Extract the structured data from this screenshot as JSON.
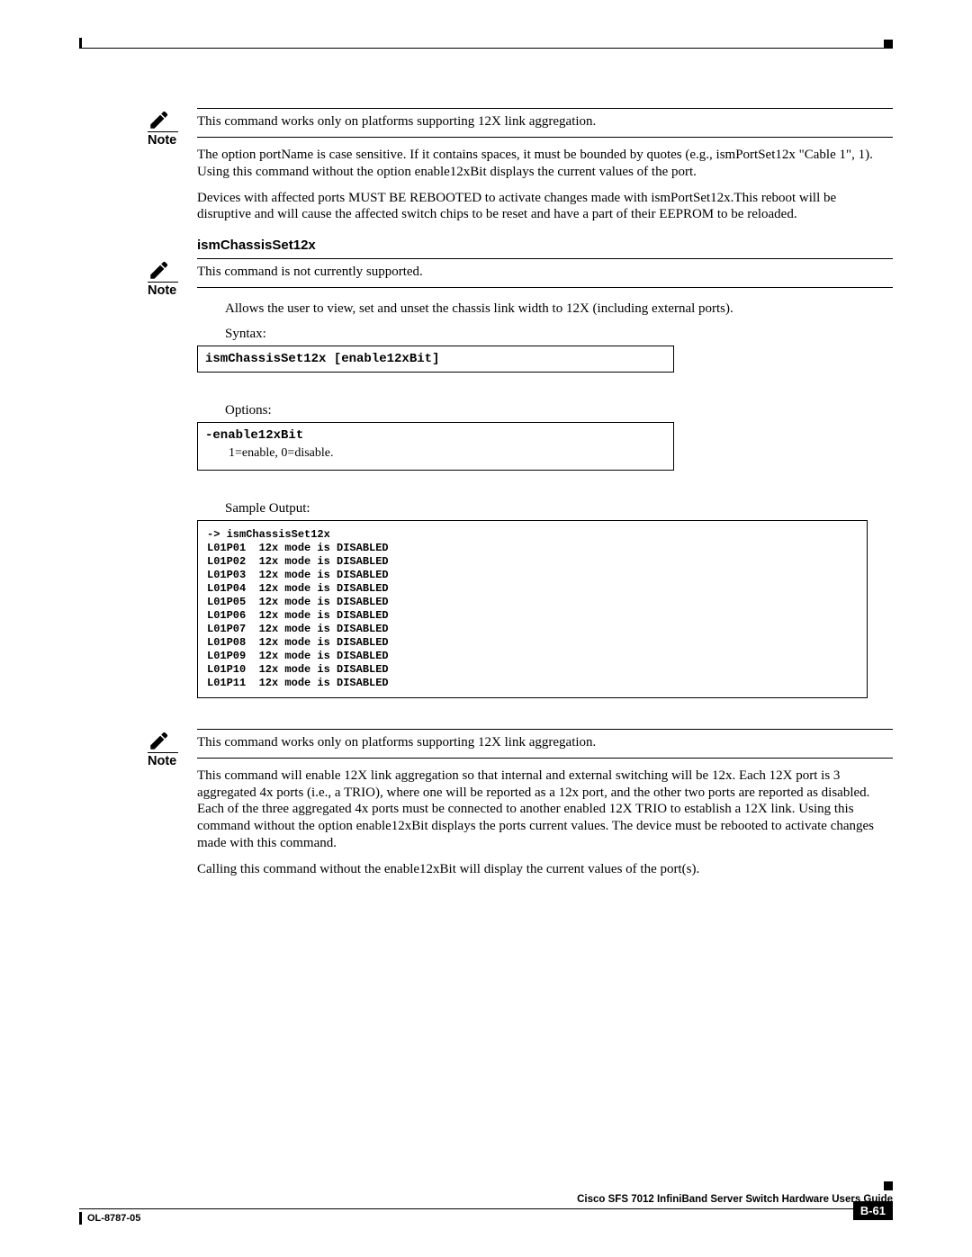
{
  "notes": {
    "label": "Note",
    "n1": "This command works only on platforms supporting 12X link aggregation.",
    "n2": "This command is not currently supported.",
    "n3": "This command works only on platforms supporting 12X link aggregation."
  },
  "paras": {
    "p1": "The option portName is case sensitive. If it contains spaces, it must be bounded by quotes (e.g., ismPortSet12x \"Cable 1\", 1). Using this command without the option enable12xBit displays the current values of the port.",
    "p2": "Devices with affected ports MUST BE REBOOTED to activate changes made with ismPortSet12x.This reboot will be disruptive and will cause the affected switch chips to be reset and have a part of their EEPROM to be reloaded.",
    "p3": "Allows the user to view, set and unset the chassis link width to 12X (including external ports).",
    "p4": "This command will enable 12X link aggregation so that internal and external switching will be 12x. Each 12X port is 3 aggregated 4x ports (i.e., a TRIO), where one will be reported as a 12x port, and the other two ports are reported as disabled.  Each of the three aggregated 4x ports must be connected to another enabled 12X TRIO to establish a 12X link. Using this command without the option enable12xBit displays the ports current values. The device must be rebooted to activate changes made with this command.",
    "p5": "Calling this command without the enable12xBit will display the current values of the port(s)."
  },
  "heading1": "ismChassisSet12x",
  "labels": {
    "syntax": "Syntax:",
    "options": "Options:",
    "sample": "Sample Output:"
  },
  "syntax_box": "ismChassisSet12x [enable12xBit]",
  "options": {
    "name": "-enable12xBit",
    "desc": "1=enable, 0=disable."
  },
  "sample_output": "-> ismChassisSet12x\nL01P01  12x mode is DISABLED\nL01P02  12x mode is DISABLED\nL01P03  12x mode is DISABLED\nL01P04  12x mode is DISABLED\nL01P05  12x mode is DISABLED\nL01P06  12x mode is DISABLED\nL01P07  12x mode is DISABLED\nL01P08  12x mode is DISABLED\nL01P09  12x mode is DISABLED\nL01P10  12x mode is DISABLED\nL01P11  12x mode is DISABLED",
  "footer": {
    "title": "Cisco SFS 7012 InfiniBand Server Switch Hardware Users Guide",
    "doc": "OL-8787-05",
    "page": "B-61"
  }
}
